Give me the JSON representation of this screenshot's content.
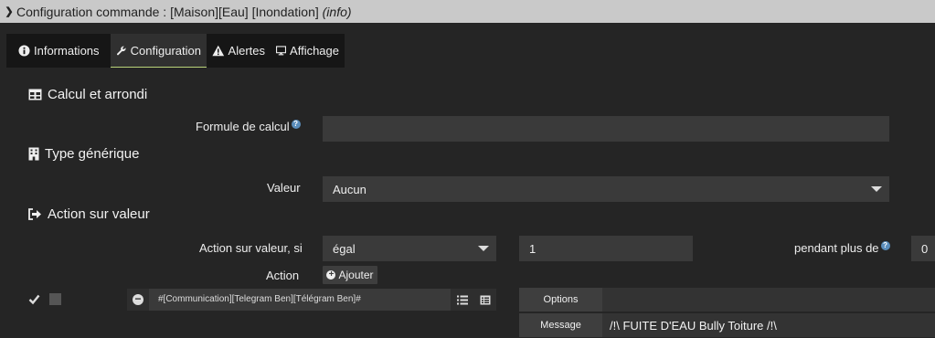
{
  "header": {
    "title_prefix": "Configuration commande : [Maison][Eau] [Inondation] ",
    "title_info": "(info)"
  },
  "tabs": [
    {
      "label": "Informations"
    },
    {
      "label": "Configuration"
    },
    {
      "label": "Alertes"
    },
    {
      "label": "Affichage"
    }
  ],
  "calcul": {
    "heading": "Calcul et arrondi",
    "formula_label": "Formule de calcul",
    "formula_value": ""
  },
  "generic": {
    "heading": "Type générique",
    "value_label": "Valeur",
    "value_selected": "Aucun"
  },
  "action": {
    "heading": "Action sur valeur",
    "condition_label": "Action sur valeur, si",
    "operator_selected": "égal",
    "compare_value": "1",
    "duration_label": "pendant plus de",
    "duration_value": "0",
    "action_label": "Action",
    "add_button": "Ajouter",
    "command_text": "#[Communication][Telegram Ben][Télégram Ben]#",
    "options_label": "Options",
    "options_value": "",
    "message_label": "Message",
    "message_value": "/!\\ FUITE D'EAU Bully Toiture /!\\"
  },
  "colors": {
    "accent_tab_underline": "#b9d37a",
    "help_icon": "#5a8dbb"
  }
}
